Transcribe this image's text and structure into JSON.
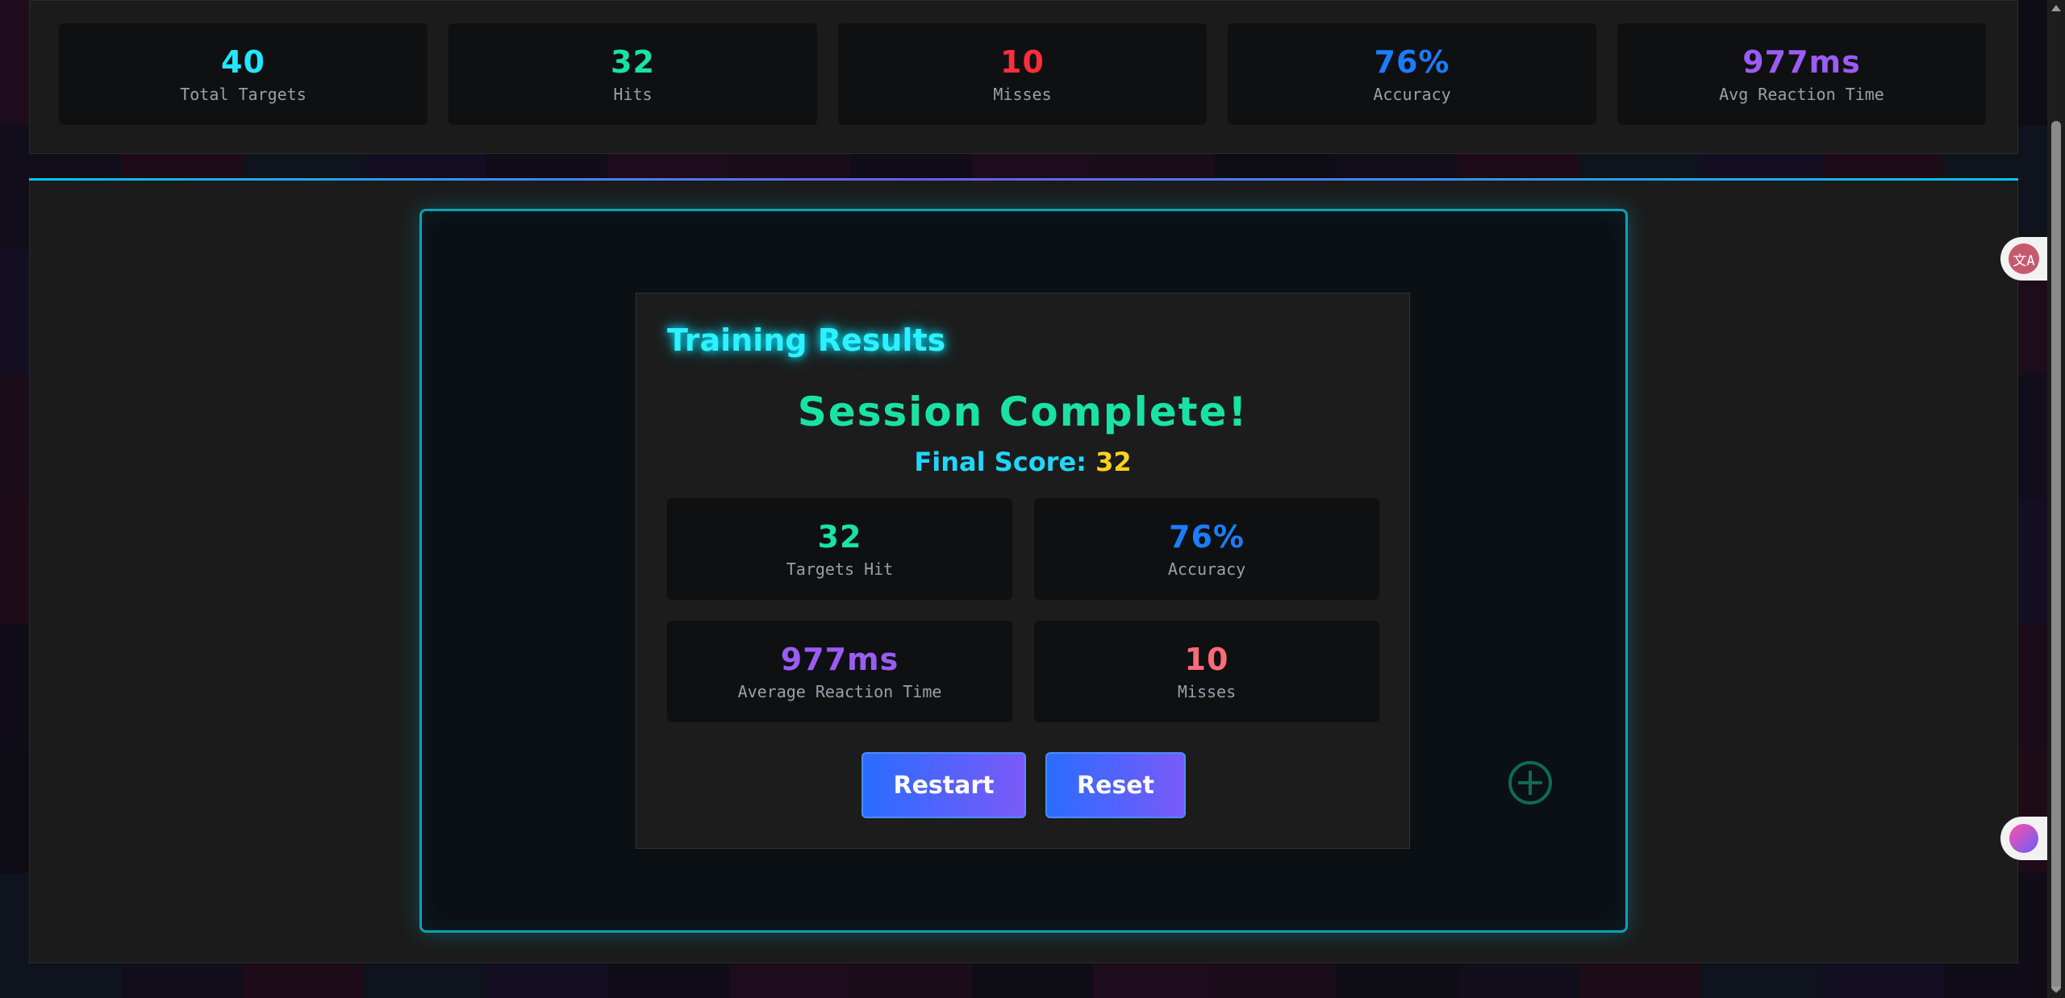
{
  "colors": {
    "cyan": "#20e6ff",
    "green": "#18e3a4",
    "red": "#ff2e3d",
    "blue": "#1b7cff",
    "purple": "#9b5cf6",
    "pink": "#ff6b78",
    "yellow": "#ffd21a"
  },
  "stats": [
    {
      "value": "40",
      "label": "Total Targets",
      "color": "#20e6ff"
    },
    {
      "value": "32",
      "label": "Hits",
      "color": "#18e3a4"
    },
    {
      "value": "10",
      "label": "Misses",
      "color": "#ff2e3d"
    },
    {
      "value": "76%",
      "label": "Accuracy",
      "color": "#1b7cff"
    },
    {
      "value": "977ms",
      "label": "Avg Reaction Time",
      "color": "#9b5cf6"
    }
  ],
  "results": {
    "title": "Training Results",
    "heading": "Session Complete!",
    "final_score_label": "Final Score:",
    "final_score_value": "32",
    "cards": [
      {
        "value": "32",
        "label": "Targets Hit",
        "color": "#18e3a4"
      },
      {
        "value": "76%",
        "label": "Accuracy",
        "color": "#1b7cff"
      },
      {
        "value": "977ms",
        "label": "Average Reaction Time",
        "color": "#9b5cf6"
      },
      {
        "value": "10",
        "label": "Misses",
        "color": "#ff6b78"
      }
    ],
    "restart_label": "Restart",
    "reset_label": "Reset"
  },
  "extensions": {
    "translate_glyph": "文A"
  },
  "icons": [
    "crosshair-icon",
    "translate-icon",
    "brain-icon"
  ]
}
